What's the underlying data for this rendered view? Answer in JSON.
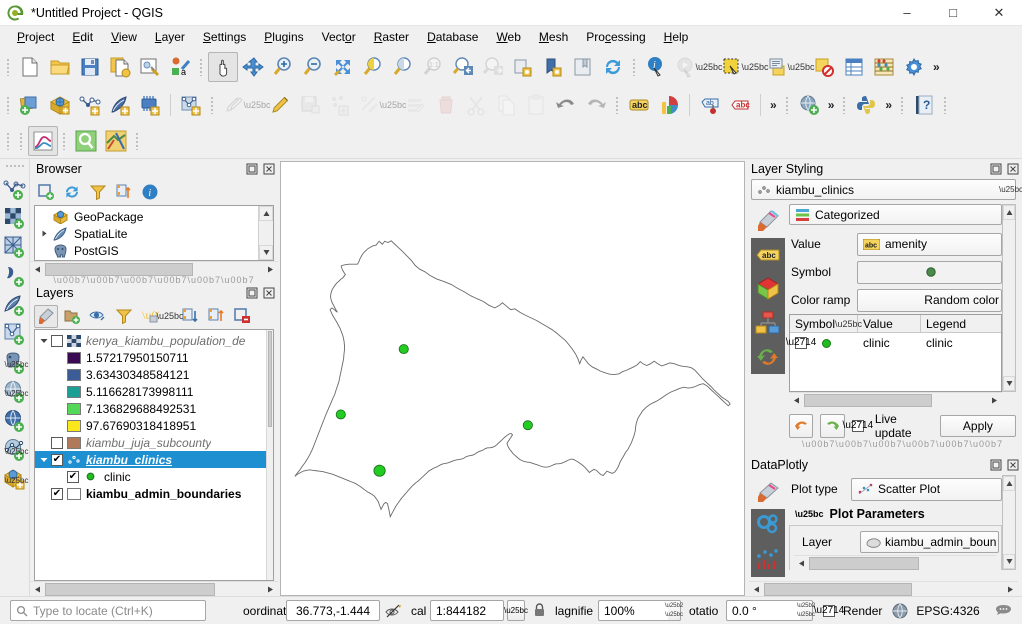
{
  "window": {
    "title": "*Untitled Project - QGIS",
    "app_icon": "qgis-logo-icon",
    "minimize": "–",
    "maximize": "□",
    "close": "✕"
  },
  "menubar": {
    "items": [
      {
        "label": "Project",
        "mnemonic": "P"
      },
      {
        "label": "Edit",
        "mnemonic": "E"
      },
      {
        "label": "View",
        "mnemonic": "V"
      },
      {
        "label": "Layer",
        "mnemonic": "L"
      },
      {
        "label": "Settings",
        "mnemonic": "S"
      },
      {
        "label": "Plugins",
        "mnemonic": "P"
      },
      {
        "label": "Vector",
        "mnemonic": "o"
      },
      {
        "label": "Raster",
        "mnemonic": "R"
      },
      {
        "label": "Database",
        "mnemonic": "D"
      },
      {
        "label": "Web",
        "mnemonic": "W"
      },
      {
        "label": "Mesh",
        "mnemonic": "M"
      },
      {
        "label": "Processing",
        "mnemonic": "c"
      },
      {
        "label": "Help",
        "mnemonic": "H"
      }
    ]
  },
  "toolbar_row1": {
    "icons": [
      "new-project-icon",
      "open-project-icon",
      "save-project-icon",
      "save-project-as-icon",
      "new-print-layout-icon",
      "style-manager-icon",
      "pan-map-icon",
      "pan-to-selection-icon",
      "zoom-in-icon",
      "zoom-out-icon",
      "zoom-full-icon",
      "zoom-to-selection-icon",
      "zoom-to-layer-icon",
      "zoom-native-icon",
      "zoom-last-icon",
      "zoom-next-icon",
      "refresh-layer-icon",
      "new-bookmark-icon",
      "show-bookmarks-icon",
      "refresh-icon",
      "identify-features-icon",
      "run-feature-action-icon",
      "select-features-icon",
      "select-value-icon",
      "deselect-features-icon",
      "open-attribute-table-icon",
      "field-calculator-icon",
      "options-icon"
    ],
    "overflow": "»",
    "active": "pan-map-icon"
  },
  "toolbar_row2": {
    "icons": [
      "add-vector-layer-icon",
      "add-raster-layer-icon",
      "add-delimited-text-icon",
      "add-spatialite-icon",
      "add-mesh-layer-icon",
      "new-virtual-layer-icon",
      "current-edits-icon",
      "toggle-editing-icon",
      "save-layer-edits-icon",
      "add-point-feature-icon",
      "vertex-tool-icon",
      "modify-attributes-icon",
      "delete-selected-icon",
      "cut-features-icon",
      "copy-features-icon",
      "paste-features-icon",
      "undo-icon",
      "redo-icon",
      "label-icon",
      "diagram-icon",
      "pin-labels-icon",
      "highlight-labels-icon"
    ],
    "overflow": "»",
    "web_icon": "add-wms-layer-icon",
    "python_icon": "python-console-icon",
    "help_icon": "help-contents-icon"
  },
  "toolbar_row3": {
    "icons": [
      "dataplotly-plot-icon",
      "search-plugin-icon",
      "qgis2web-icon"
    ],
    "active": "dataplotly-plot-icon"
  },
  "left_toolbar": {
    "icons": [
      "new-shapefile-layer-icon",
      "new-geopackage-layer-icon",
      "new-spatialite-layer-icon",
      "new-gpx-layer-icon",
      "add-delimited-text-icon",
      "new-virtual-layer-icon",
      "add-postgis-layer-icon",
      "add-arcgis-server-icon",
      "add-wms-layer-icon",
      "add-wfs-layer-icon",
      "add-geopackage-layer-icon"
    ]
  },
  "browser_panel": {
    "title": "Browser",
    "undock_icon": "undock-icon",
    "close_icon": "close-icon",
    "toolbar": [
      "add-layer-icon",
      "refresh-icon",
      "filter-icon",
      "collapse-all-icon",
      "properties-icon"
    ],
    "items": [
      {
        "label": "GeoPackage",
        "icon": "geopackage-icon",
        "expandable": false
      },
      {
        "label": "SpatiaLite",
        "icon": "spatialite-icon",
        "expandable": true
      },
      {
        "label": "PostGIS",
        "icon": "postgis-icon",
        "expandable": false
      }
    ]
  },
  "layers_panel": {
    "title": "Layers",
    "undock_icon": "undock-icon",
    "close_icon": "close-icon",
    "toolbar": [
      "open-layer-styling-icon",
      "add-group-icon",
      "manage-visibility-icon",
      "filter-legend-icon",
      "expression-filter-icon",
      "expand-all-icon",
      "collapse-all-icon",
      "remove-layer-icon"
    ],
    "items": [
      {
        "label": "kenya_kiambu_population_de",
        "type": "raster",
        "checked": false,
        "expanded": true,
        "depth": 0,
        "style": "italic",
        "icon": "raster-layer-icon"
      },
      {
        "label": "1.57217950150711",
        "type": "legend-swatch",
        "color": "#3b0a54",
        "depth": 1
      },
      {
        "label": "3.63430348584121",
        "type": "legend-swatch",
        "color": "#3b5c96",
        "depth": 1
      },
      {
        "label": "5.116628173998111",
        "type": "legend-swatch",
        "color": "#1b9e94",
        "depth": 1
      },
      {
        "label": "7.136829688492531",
        "type": "legend-swatch",
        "color": "#53d957",
        "depth": 1
      },
      {
        "label": "97.67690318418951",
        "type": "legend-swatch",
        "color": "#fbe81c",
        "depth": 1
      },
      {
        "label": "kiambu_juja_subcounty",
        "type": "vector-polygon",
        "checked": false,
        "depth": 0,
        "style": "italic",
        "color": "#b07a5a"
      },
      {
        "label": "kiambu_clinics",
        "type": "vector-point",
        "checked": true,
        "expanded": true,
        "depth": 0,
        "selected": true
      },
      {
        "label": "clinic",
        "type": "symbol",
        "checked": true,
        "depth": 1,
        "color": "#22bb22"
      },
      {
        "label": "kiambu_admin_boundaries",
        "type": "vector-polygon",
        "checked": true,
        "depth": 0,
        "style": "bold",
        "color": "#ffffff"
      }
    ]
  },
  "layer_styling_panel": {
    "title": "Layer Styling",
    "undock_icon": "undock-icon",
    "close_icon": "close-icon",
    "layer_selector": {
      "value": "kiambu_clinics",
      "icon": "point-layer-icon"
    },
    "tabs": [
      {
        "name": "symbology-tab",
        "icon": "paintbrush-icon",
        "selected": true
      },
      {
        "name": "labels-tab",
        "icon": "abc-label-icon"
      },
      {
        "name": "3d-view-tab",
        "icon": "3d-cube-icon"
      },
      {
        "name": "diagrams-tab",
        "icon": "diagram-icon"
      },
      {
        "name": "history-tab",
        "icon": "undo-redo-icon"
      }
    ],
    "renderer": {
      "value": "Categorized",
      "icon": "categorized-icon"
    },
    "fields": [
      {
        "label": "Value",
        "value": "amenity",
        "icon": "abc-field-icon"
      },
      {
        "label": "Symbol",
        "value": "",
        "icon": "green-dot-icon"
      },
      {
        "label": "Color ramp",
        "value": "Random color"
      }
    ],
    "table": {
      "headers": [
        "Symbol",
        "Value",
        "Legend"
      ],
      "sort_icon": "sort-arrow-icon",
      "rows": [
        {
          "checked": true,
          "symbol_color": "#22bb22",
          "value": "clinic",
          "legend": "clinic"
        }
      ]
    },
    "footer": {
      "undo_icon": "undo-icon",
      "redo_icon": "redo-icon",
      "live_update_label": "Live update",
      "live_update_checked": true,
      "apply_label": "Apply"
    }
  },
  "dataplotly_panel": {
    "title": "DataPlotly",
    "undock_icon": "undock-icon",
    "close_icon": "close-icon",
    "tabs": [
      {
        "name": "plot-type-tab",
        "icon": "paintbrush-icon",
        "selected": true
      },
      {
        "name": "plot-settings-tab",
        "icon": "gears-icon"
      },
      {
        "name": "plot-output-tab",
        "icon": "bar-chart-icon"
      }
    ],
    "plot_type": {
      "label": "Plot type",
      "value": "Scatter Plot",
      "icon": "scatter-plot-icon"
    },
    "section": {
      "label": "Plot Parameters",
      "expanded": true
    },
    "layer_field": {
      "label": "Layer",
      "value": "kiambu_admin_boun",
      "icon": "polygon-layer-icon"
    }
  },
  "map_canvas": {
    "name": "map-canvas",
    "clinic_points": [
      {
        "cx": 0.265,
        "cy": 0.432,
        "r": 4.5
      },
      {
        "cx": 0.129,
        "cy": 0.583,
        "r": 4.5
      },
      {
        "cx": 0.533,
        "cy": 0.608,
        "r": 4.5
      },
      {
        "cx": 0.213,
        "cy": 0.713,
        "r": 5.5
      }
    ],
    "point_color": "#22cc22",
    "boundary_color": "#6b6b6b"
  },
  "statusbar": {
    "locator_placeholder": "Type to locate (Ctrl+K)",
    "search_icon": "search-icon",
    "coordinate_label": "oordinat",
    "coordinate_value": "36.773,-1.444",
    "coordinate_toggle_icon": "toggle-extents-icon",
    "scale_label": "cal",
    "scale_value": "1:844182",
    "lock_icon": "lock-scale-icon",
    "magnifier_label": "lagnifie",
    "magnifier_value": "100%",
    "rotation_label": "otatio",
    "rotation_value": "0.0 °",
    "render_label": "Render",
    "render_checked": true,
    "crs_icon": "crs-globe-icon",
    "crs_value": "EPSG:4326",
    "messages_icon": "messages-icon"
  }
}
